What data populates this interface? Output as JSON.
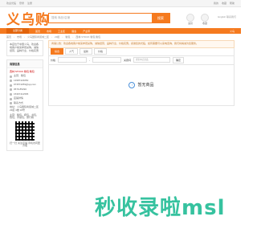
{
  "topbar": {
    "left": [
      "欢迎光临",
      "登录",
      "注册"
    ],
    "right": [
      "我的",
      "收藏",
      "帮助"
    ]
  },
  "header": {
    "logo": "义乌购",
    "search_placeholder": "搜索 商品/店铺",
    "search_button": "搜索",
    "icons": [
      "进货",
      "收藏"
    ],
    "right_text": "English 联系我们"
  },
  "nav": {
    "category": "全部分类",
    "items": [
      "首页",
      "市场",
      "工业区",
      "展会",
      "产业带"
    ],
    "right": "义乌"
  },
  "breadcrumb": [
    "首页",
    "市场",
    "义乌国际商贸城二区",
    "23街",
    "箱包",
    "西林 STOCK 箱包 箱包"
  ],
  "sidebar": {
    "intro": "本店位于中国义乌，欢迎各地客户前来参观采购，诚信经营，品种齐全，价格实惠",
    "store_title": "商铺信息",
    "store_name": "西林 STOCK 箱包 箱包",
    "rows": [
      "主营：箱包",
      "13987423050",
      "973574259@qq.com",
      "0579-85290",
      "15367412565",
      "店铺详情",
      "联系方式"
    ],
    "address": "地址：义乌国际商贸城二区 23街 4楼 18号",
    "products": "主营：箱包，挎包，书包，钱包，手提包，旅行箱",
    "qr_text": "扫一扫 关注店铺 手机访问更方便"
  },
  "main": {
    "notice": "商铺公告：欢迎各地客户前来参观采购，诚信经营，品种齐全，价格实惠。感谢您的光临，如有需要可以来电咨询，我们将竭诚为您服务。",
    "tabs": [
      "综合",
      "人气",
      "最新",
      "价格"
    ],
    "filters": {
      "label": "价格",
      "keyword_label": "关键词",
      "placeholder": "搜索本店商品",
      "button": "确定"
    },
    "empty_text": "暂无商品"
  },
  "watermark": "秒收录啦msl"
}
